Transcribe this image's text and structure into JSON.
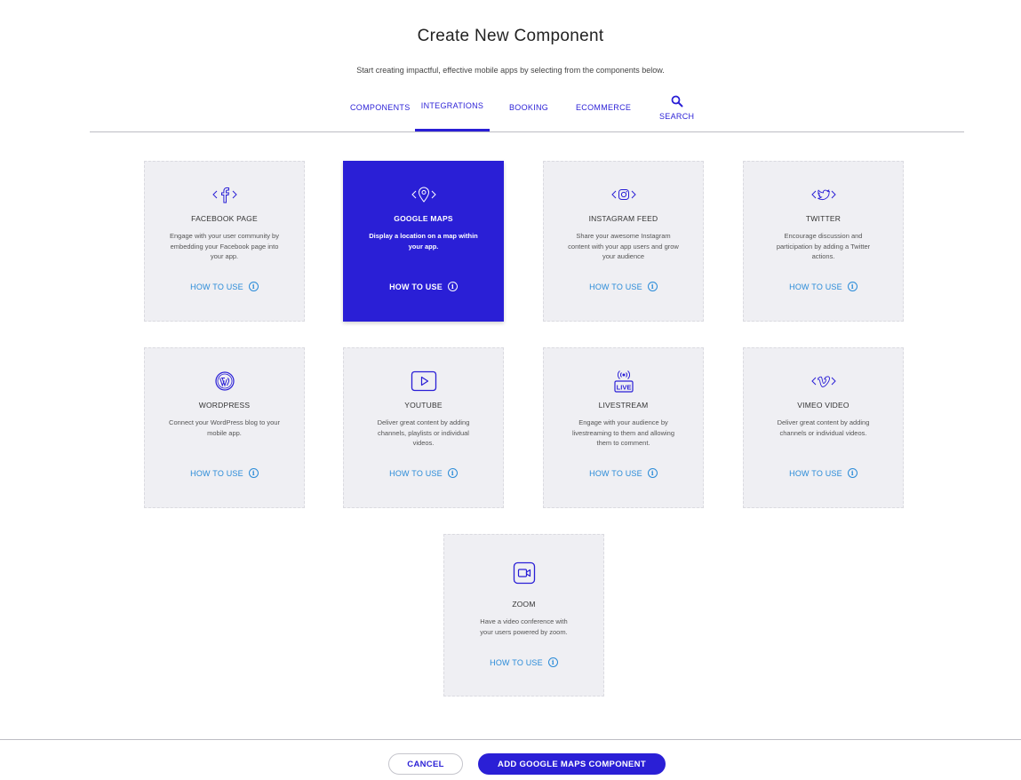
{
  "header": {
    "title": "Create New Component",
    "subtitle": "Start creating impactful, effective mobile apps by selecting from the components below."
  },
  "tabs": [
    {
      "label": "COMPONENTS",
      "active": false
    },
    {
      "label": "INTEGRATIONS",
      "active": true
    },
    {
      "label": "BOOKING",
      "active": false
    },
    {
      "label": "ECOMMERCE",
      "active": false
    },
    {
      "label": "SEARCH",
      "icon": "search-icon",
      "active": false
    }
  ],
  "cards": [
    {
      "name": "FACEBOOK PAGE",
      "icon": "facebook-icon",
      "desc": "Engage with your user community by embedding your Facebook page into your app.",
      "how": "HOW TO USE",
      "selected": false
    },
    {
      "name": "GOOGLE MAPS",
      "icon": "map-pin-icon",
      "desc": "Display a location on a map within your app.",
      "how": "HOW TO USE",
      "selected": true
    },
    {
      "name": "INSTAGRAM FEED",
      "icon": "instagram-icon",
      "desc": "Share your awesome Instagram content with your app users and grow your audience",
      "how": "HOW TO USE",
      "selected": false
    },
    {
      "name": "TWITTER",
      "icon": "twitter-icon",
      "desc": "Encourage discussion and participation by adding a Twitter actions.",
      "how": "HOW TO USE",
      "selected": false
    },
    {
      "name": "WORDPRESS",
      "icon": "wordpress-icon",
      "desc": "Connect your WordPress blog to your mobile app.",
      "how": "HOW TO USE",
      "selected": false
    },
    {
      "name": "YOUTUBE",
      "icon": "youtube-icon",
      "desc": "Deliver great content by adding channels, playlists or individual videos.",
      "how": "HOW TO USE",
      "selected": false
    },
    {
      "name": "LIVESTREAM",
      "icon": "livestream-icon",
      "icon_text": "LIVE",
      "desc": "Engage with your audience by livestreaming to them and allowing them to comment.",
      "how": "HOW TO USE",
      "selected": false
    },
    {
      "name": "VIMEO VIDEO",
      "icon": "vimeo-icon",
      "desc": "Deliver great content by adding channels or individual videos.",
      "how": "HOW TO USE",
      "selected": false
    },
    {
      "name": "ZOOM",
      "icon": "zoom-icon",
      "desc": "Have a video conference with your users powered by zoom.",
      "how": "HOW TO USE",
      "selected": false
    }
  ],
  "footer": {
    "cancel_label": "CANCEL",
    "add_label": "ADD GOOGLE MAPS COMPONENT"
  },
  "colors": {
    "accent": "#2a1fd6",
    "link": "#2a8bd8",
    "card_bg": "#efeff3"
  }
}
